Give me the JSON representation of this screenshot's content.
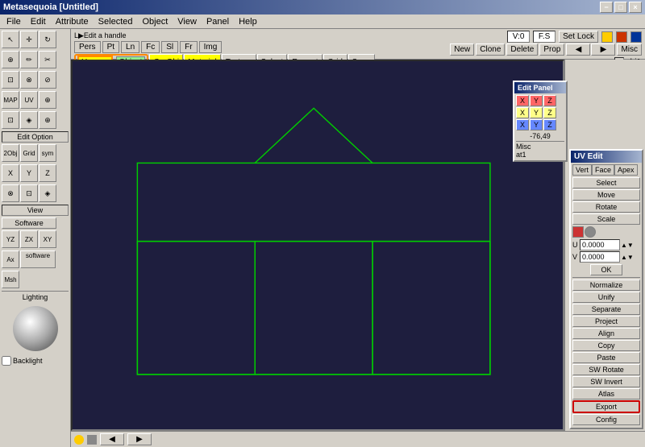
{
  "window": {
    "title": "Metasequoia [Untitled]"
  },
  "titlebar": {
    "title": "Metasequoia [Untitled]",
    "minimize": "−",
    "maximize": "□",
    "close": "×"
  },
  "menu": {
    "items": [
      "File",
      "Edit",
      "Attribute",
      "Selected",
      "Object",
      "View",
      "Panel",
      "Help"
    ]
  },
  "topbar": {
    "v0_label": "V:0",
    "fs_label": "F.S",
    "setlock_label": "Set Lock",
    "new_label": "New",
    "clone_label": "Clone",
    "delete_label": "Delete",
    "prop_label": "Prop",
    "misc_label": "Misc",
    "obj1_label": "obj1"
  },
  "leftpanel": {
    "handle_text": "L▶Edit a handle",
    "tabs": [
      "Pers",
      "Pt",
      "Ln",
      "Fc",
      "Sl",
      "Fr",
      "Img"
    ],
    "unwrap_label": "Unwrap",
    "object_label": "Object",
    "curobj_label": "CurObj",
    "material_label": "Material",
    "texture_label": "Texture",
    "select_label": "Select",
    "repeat_label": "Repeat",
    "grid_label": "Grid",
    "snap_label": "Snap"
  },
  "lefttoolbar": {
    "sections": [
      {
        "name": "transform",
        "tools": [
          "↖",
          "↔",
          "↕",
          "⊕",
          "⟳",
          "⊘"
        ]
      },
      {
        "name": "shape",
        "tools": [
          "▣",
          "⊡",
          "◈",
          "⬡",
          "⊘",
          "⊕"
        ]
      }
    ],
    "edit_option_label": "Edit Option",
    "view_label": "View",
    "software_label": "Software",
    "yz_label": "YZ",
    "zx_label": "ZX",
    "xy_label": "XY",
    "ax_label": "Ax",
    "software2_label": "software",
    "msh_label": "Msh",
    "lighting_label": "Lighting",
    "backlight_label": "Backlight"
  },
  "uv_edit": {
    "title": "UV Edit",
    "tabs": [
      "Vert",
      "Face",
      "Apex"
    ],
    "buttons": [
      "Select",
      "Move",
      "Rotate",
      "Scale"
    ],
    "u_label": "U",
    "v_label": "V",
    "u_value": "0.0000",
    "v_value": "0.0000",
    "ok_label": "OK",
    "normalize_label": "Normalize",
    "unify_label": "Unify",
    "separate_label": "Separate",
    "project_label": "Project",
    "align_label": "Align",
    "copy_label": "Copy",
    "paste_label": "Paste",
    "sw_rotate_label": "SW Rotate",
    "sw_invert_label": "SW Invert",
    "atlas_label": "Atlas",
    "export_label": "Export",
    "config_label": "Config"
  },
  "edit_panel": {
    "title": "Edit Panel",
    "xyz_x_red": "X",
    "xyz_y_red": "Y",
    "xyz_z_red": "Z",
    "xyz_x_green": "X",
    "xyz_y_green": "Y",
    "xyz_z_green": "Z",
    "xyz_x_blue": "X",
    "xyz_y_blue": "Y",
    "xyz_z_blue": "Z",
    "misc_label": "Misc",
    "coords_label": "-76,49",
    "at1_label": "at1"
  },
  "status_bar": {
    "arrow_left": "◀",
    "arrow_right": "▶",
    "dot": "●"
  },
  "colors": {
    "accent": "#ffff00",
    "highlight": "#ff8800",
    "export_border": "#cc0000",
    "green_shape": "#00cc00",
    "viewport_bg": "#1a1a3a",
    "uv_shape": "#00cc00"
  }
}
